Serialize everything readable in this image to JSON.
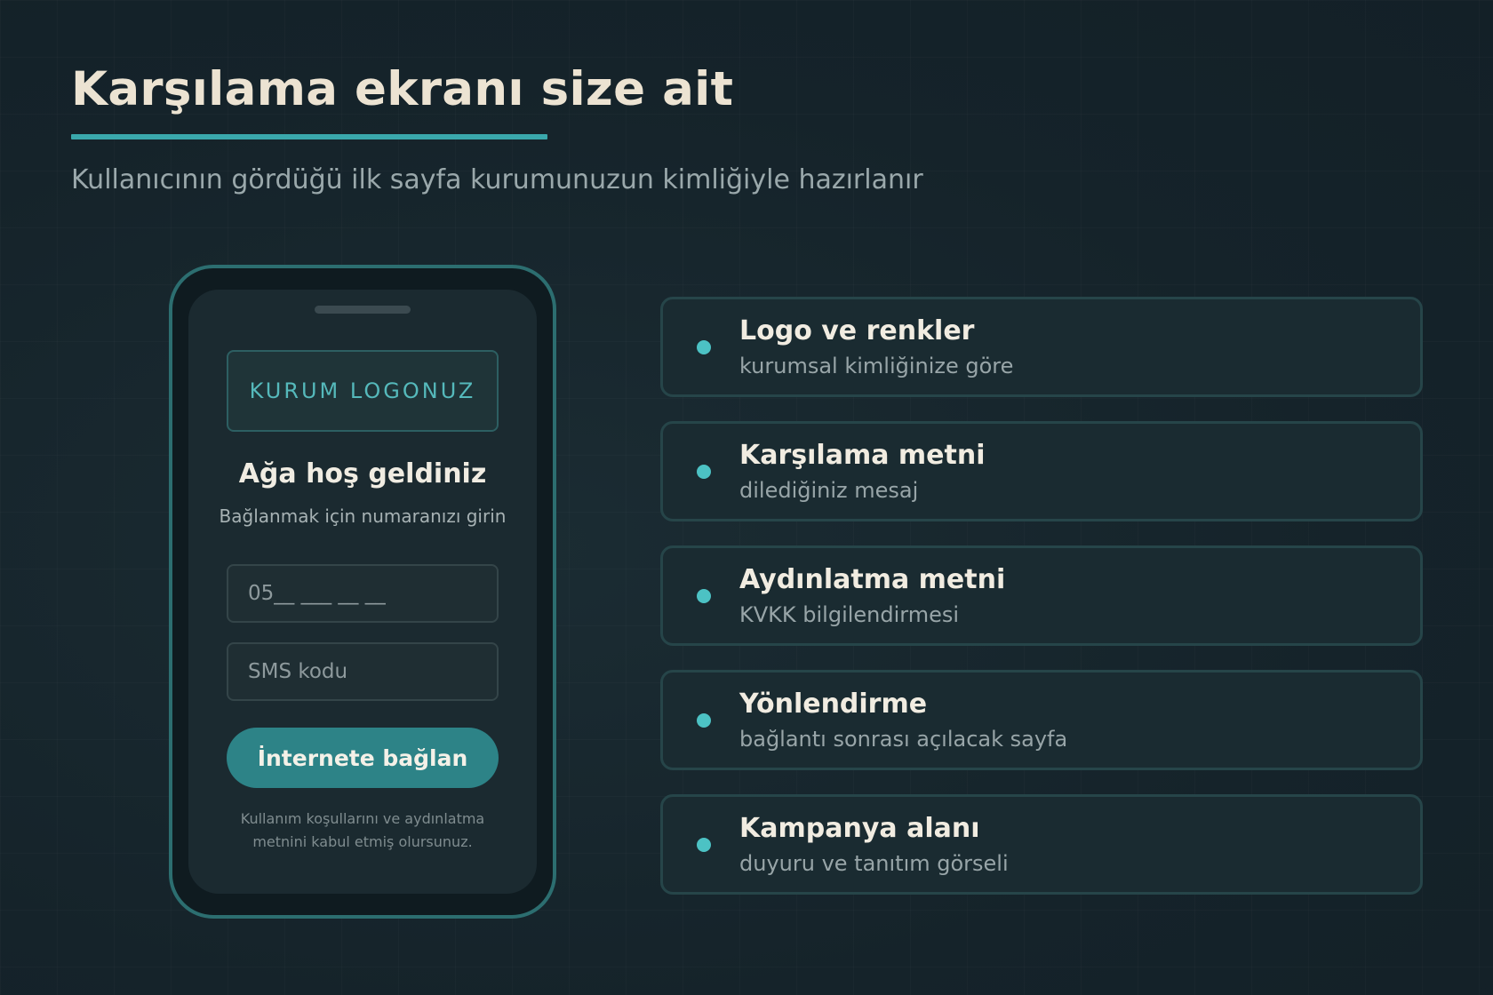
{
  "header": {
    "title": "Karşılama ekranı size ait",
    "subtitle": "Kullanıcının gördüğü ilk sayfa kurumunuzun kimliğiyle hazırlanır"
  },
  "phone": {
    "logo_label": "KURUM LOGONUZ",
    "welcome_title": "Ağa hoş geldiniz",
    "welcome_subtitle": "Bağlanmak için numaranızı girin",
    "phone_placeholder": "05__ ___ __ __",
    "sms_placeholder": "SMS kodu",
    "connect_label": "İnternete bağlan",
    "terms_text": "Kullanım koşullarını ve aydınlatma metnini kabul etmiş olursunuz."
  },
  "features": [
    {
      "title": "Logo ve renkler",
      "description": "kurumsal kimliğinize göre"
    },
    {
      "title": "Karşılama metni",
      "description": "dilediğiniz mesaj"
    },
    {
      "title": "Aydınlatma metni",
      "description": "KVKK bilgilendirmesi"
    },
    {
      "title": "Yönlendirme",
      "description": "bağlantı sonrası açılacak sayfa"
    },
    {
      "title": "Kampanya alanı",
      "description": "duyuru ve tanıtım görseli"
    }
  ],
  "colors": {
    "background": "#16242b",
    "accent": "#3aa8ac",
    "button": "#2d8387",
    "bullet": "#4cc2c4"
  },
  "icons": {
    "feature_bullet": "dot-icon"
  }
}
